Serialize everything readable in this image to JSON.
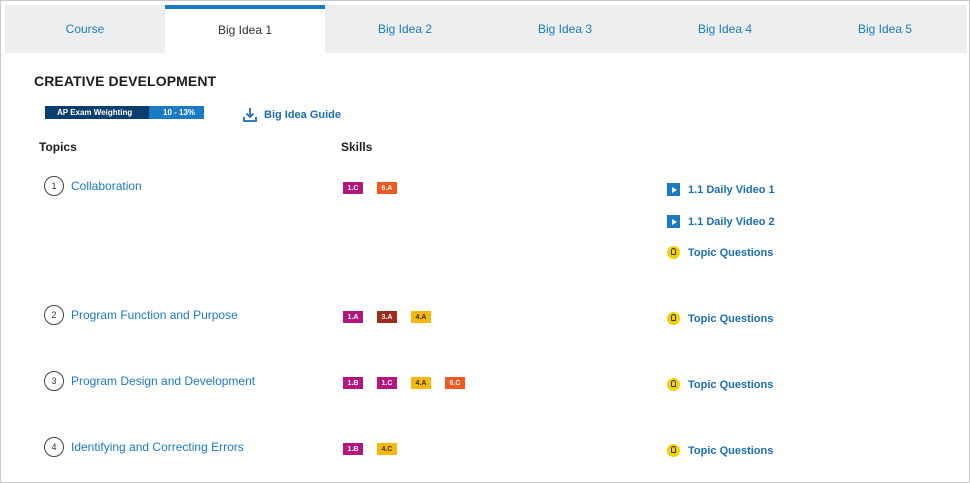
{
  "tabs": [
    {
      "label": "Course",
      "active": false
    },
    {
      "label": "Big Idea 1",
      "active": true
    },
    {
      "label": "Big Idea 2",
      "active": false
    },
    {
      "label": "Big Idea 3",
      "active": false
    },
    {
      "label": "Big Idea 4",
      "active": false
    },
    {
      "label": "Big Idea 5",
      "active": false
    }
  ],
  "unit": {
    "title": "CREATIVE DEVELOPMENT",
    "weighting_label": "AP Exam Weighting",
    "weighting_value": "10 - 13%",
    "guide_label": "Big Idea Guide"
  },
  "headers": {
    "topics": "Topics",
    "skills": "Skills"
  },
  "topics": [
    {
      "number": "1",
      "name": "Collaboration",
      "skills": [
        {
          "code": "1.C",
          "color": "#b5157f"
        },
        {
          "code": "6.A",
          "color": "#f05a22"
        }
      ],
      "resources": [
        {
          "label": "1.1 Daily Video 1",
          "icon": "video-icon"
        },
        {
          "label": "1.1 Daily Video 2",
          "icon": "video-icon"
        },
        {
          "label": "Topic Questions",
          "icon": "lightbulb-icon"
        }
      ]
    },
    {
      "number": "2",
      "name": "Program Function and Purpose",
      "skills": [
        {
          "code": "1.A",
          "color": "#b5157f"
        },
        {
          "code": "3.A",
          "color": "#a12a1e"
        },
        {
          "code": "4.A",
          "color": "#f5b80b"
        }
      ],
      "resources": [
        {
          "label": "Topic Questions",
          "icon": "lightbulb-icon"
        }
      ]
    },
    {
      "number": "3",
      "name": "Program Design and Development",
      "skills": [
        {
          "code": "1.B",
          "color": "#b5157f"
        },
        {
          "code": "1.C",
          "color": "#b5157f"
        },
        {
          "code": "4.A",
          "color": "#f5b80b"
        },
        {
          "code": "6.C",
          "color": "#f05a22"
        }
      ],
      "resources": [
        {
          "label": "Topic Questions",
          "icon": "lightbulb-icon"
        }
      ]
    },
    {
      "number": "4",
      "name": "Identifying and Correcting Errors",
      "skills": [
        {
          "code": "1.B",
          "color": "#b5157f"
        },
        {
          "code": "4.C",
          "color": "#f5b80b"
        }
      ],
      "resources": [
        {
          "label": "Topic Questions",
          "icon": "lightbulb-icon"
        }
      ]
    }
  ]
}
